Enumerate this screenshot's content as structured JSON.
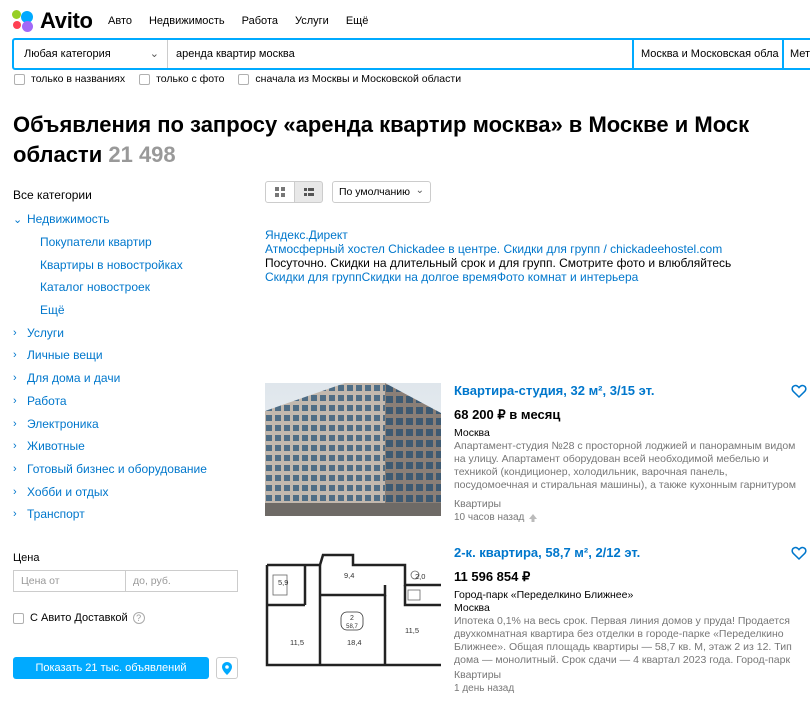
{
  "header": {
    "logo": "Avito",
    "nav": [
      "Авто",
      "Недвижимость",
      "Работа",
      "Услуги",
      "Ещё"
    ]
  },
  "search": {
    "category": "Любая категория",
    "query": "аренда квартир москва",
    "region": "Москва и Московская обла",
    "metro": "Мет"
  },
  "filters": [
    "только в названиях",
    "только с фото",
    "сначала из Москвы и Московской области"
  ],
  "page": {
    "title_line1": "Объявления по запросу «аренда квартир москва» в Москве и Моск",
    "title_line2": "области",
    "count": "21 498"
  },
  "sidebar": {
    "heading": "Все категории",
    "realty": "Недвижимость",
    "realty_subs": [
      "Покупатели квартир",
      "Квартиры в новостройках",
      "Каталог новостроек",
      "Ещё"
    ],
    "categories": [
      "Услуги",
      "Личные вещи",
      "Для дома и дачи",
      "Работа",
      "Электроника",
      "Животные",
      "Готовый бизнес и оборудование",
      "Хобби и отдых",
      "Транспорт"
    ],
    "price_label": "Цена",
    "price_from": "Цена от",
    "price_to": "до, руб.",
    "delivery": "С Авито Доставкой",
    "show_button": "Показать 21 тыс. объявлений"
  },
  "toolbar": {
    "sort": "По умолчанию"
  },
  "ad": {
    "source": "Яндекс.Директ",
    "headline": "Атмосферный хостел Chickadee в центре. Скидки для групп / chickadeehostel.com",
    "text": "Посуточно. Скидки на длительный срок и для групп. Смотрите фото и влюбляйтесь",
    "links": "Скидки для группСкидки на долгое времяФото комнат и интерьера"
  },
  "listings": [
    {
      "title": "Квартира-студия, 32 м², 3/15 эт.",
      "price": "68 200 ₽ в месяц",
      "location": "Москва",
      "developer": "",
      "description": "Апартамент-студия №28 с просторной лоджией и панорамным видом на улицу. Апартамент оборудован всей необходимой мебелью и техникой (кондиционер, холодильник, варочная панель, посудомоечная и стиральная машины), а также кухонным гарнитуром и",
      "category": "Квартиры",
      "time": "10 часов назад"
    },
    {
      "title": "2-к. квартира, 58,7 м², 2/12 эт.",
      "price": "11 596 854 ₽",
      "developer": "Город-парк «Переделкино Ближнее»",
      "location": "Москва",
      "description": "Ипотека 0,1% на весь срок. Первая линия домов у пруда! Продается двухкомнатная квартира без отделки в городе-парке «Переделкино Ближнее». Общая площадь квартиры — 58,7 кв. М, этаж 2 из 12. Тип дома — монолитный. Срок сдачи — 4 квартал 2023 года. Город-парк",
      "category": "Квартиры",
      "time": "1 день назад",
      "plan_labels": [
        "5,9",
        "9,4",
        "2,0",
        "11,5",
        "18,4",
        "11,5",
        "2",
        "58,7"
      ]
    }
  ],
  "colors": {
    "accent": "#00aaff",
    "link": "#0077cc",
    "muted": "#777777"
  }
}
